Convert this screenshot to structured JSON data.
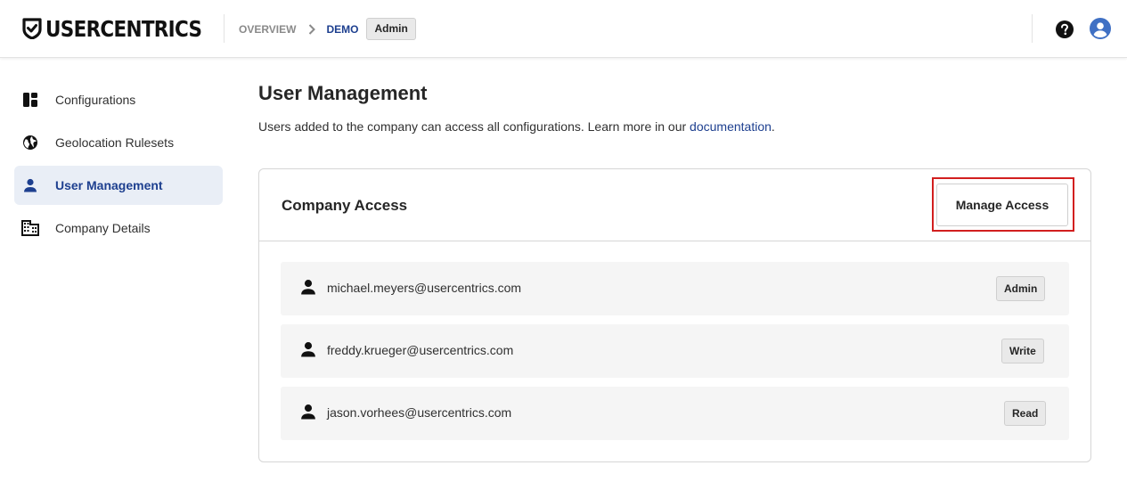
{
  "header": {
    "logo_text": "USERCENTRICS",
    "breadcrumb": {
      "overview": "OVERVIEW",
      "current": "DEMO",
      "role_badge": "Admin"
    },
    "icons": [
      "help-icon",
      "account-circle-icon"
    ]
  },
  "sidebar": {
    "items": [
      {
        "label": "Configurations",
        "icon": "dashboard-icon",
        "active": false
      },
      {
        "label": "Geolocation Rulesets",
        "icon": "globe-icon",
        "active": false
      },
      {
        "label": "User Management",
        "icon": "person-icon",
        "active": true
      },
      {
        "label": "Company Details",
        "icon": "building-icon",
        "active": false
      }
    ]
  },
  "main": {
    "title": "User Management",
    "description": "Users added to the company can access all configurations. Learn more in our",
    "description_link": "documentation",
    "description_end": ".",
    "card": {
      "title": "Company Access",
      "manage_button": "Manage Access",
      "users": [
        {
          "email": "michael.meyers@usercentrics.com",
          "role": "Admin"
        },
        {
          "email": "freddy.krueger@usercentrics.com",
          "role": "Write"
        },
        {
          "email": "jason.vorhees@usercentrics.com",
          "role": "Read"
        }
      ]
    }
  },
  "colors": {
    "accent": "#1d3f8f",
    "active_bg": "#e9eef6",
    "highlight": "#d21f1f"
  }
}
